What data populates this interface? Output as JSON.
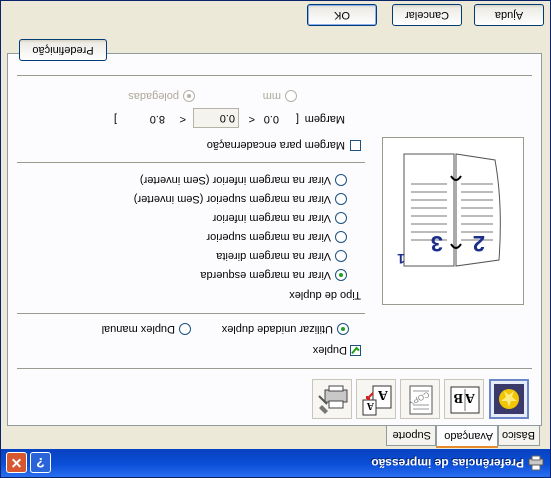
{
  "window": {
    "title": "Preferências de impressão"
  },
  "tabs": [
    "Básico",
    "Avançado",
    "Suporte"
  ],
  "icon_tabs": [
    {
      "icon": "print-quality-icon",
      "selected": true
    },
    {
      "icon": "ab-text-icon",
      "selected": false
    },
    {
      "icon": "copy-watermark-icon",
      "selected": false
    },
    {
      "icon": "a-scaling-icon",
      "selected": false
    },
    {
      "icon": "printer-settings-icon",
      "selected": false
    }
  ],
  "duplex": {
    "checkbox_label": "Duplex",
    "checked": true,
    "options": [
      "Utilizar unidade duplex",
      "Duplex manual"
    ],
    "selected_option": 0,
    "type_label": "Tipo de duplex",
    "types": [
      "Virar na margem esquerda",
      "Virar na margem direita",
      "Virar na margem superior",
      "Virar na margem inferior",
      "Virar na margem superior (Sem inverter)",
      "Virar na margem inferior (Sem inverter)"
    ],
    "selected_type": 0
  },
  "preview": {
    "page_left": "2",
    "page_right": "3",
    "page_back": "1"
  },
  "binding": {
    "checkbox_label": "Margem para encadernação",
    "margin_label": "Margem",
    "bracket_open": "[",
    "min": "0.0",
    "lt": "<",
    "value": "0.0",
    "lt2": "<",
    "max": "8.0",
    "bracket_close": "]",
    "units": [
      "polegadas",
      "mm"
    ],
    "selected_unit": 0
  },
  "default_button": "Predefinição",
  "buttons": {
    "ok": "OK",
    "cancel": "Cancelar",
    "help": "Ajuda"
  },
  "colors": {
    "title_bar": "#0a4fd8",
    "window_bg": "#ece9d8",
    "tab_accent": "#e68b2c"
  }
}
